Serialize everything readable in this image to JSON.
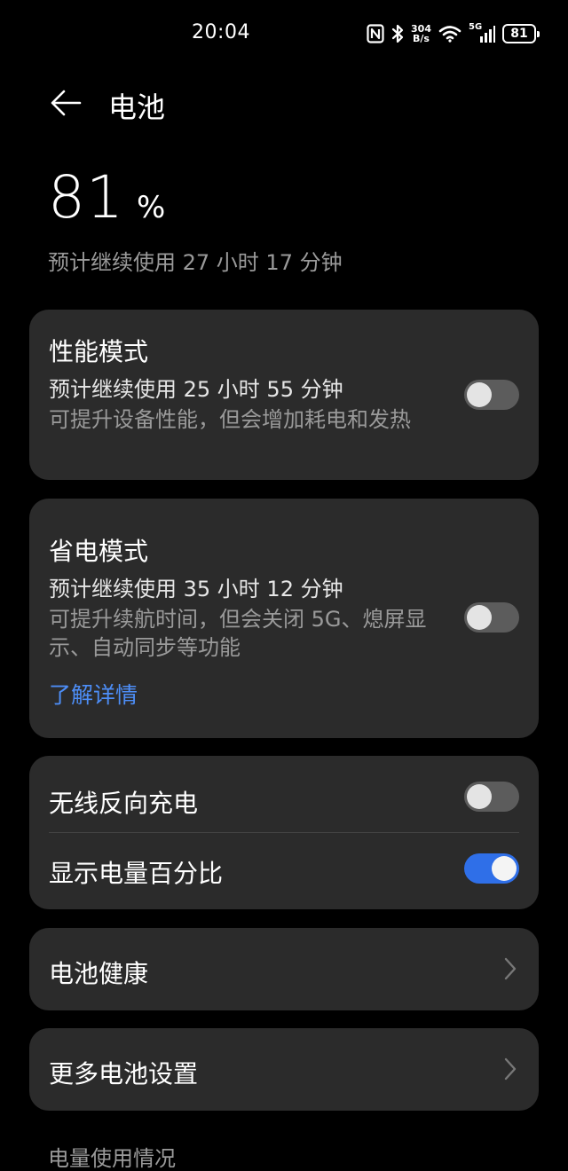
{
  "status_bar": {
    "time": "20:04",
    "net_speed_value": "304",
    "net_speed_unit": "B/s",
    "network": "5G",
    "battery": "81",
    "icons": [
      "nfc-icon",
      "bluetooth-icon",
      "wifi-icon",
      "cellular-signal-icon",
      "battery-icon"
    ]
  },
  "header": {
    "title": "电池",
    "back_icon": "arrow-left-icon"
  },
  "summary": {
    "percent": "81",
    "percent_unit": "%",
    "remaining": "预计继续使用 27 小时 17 分钟"
  },
  "performance_mode": {
    "title": "性能模式",
    "estimate": "预计继续使用 25 小时 55 分钟",
    "description": "可提升设备性能，但会增加耗电和发热",
    "enabled": false
  },
  "power_saving_mode": {
    "title": "省电模式",
    "estimate": "预计继续使用 35 小时 12 分钟",
    "description": "可提升续航时间，但会关闭 5G、熄屏显示、自动同步等功能",
    "link": "了解详情",
    "enabled": false
  },
  "toggles": {
    "wireless_reverse_charging": {
      "label": "无线反向充电",
      "enabled": false
    },
    "show_battery_percentage": {
      "label": "显示电量百分比",
      "enabled": true
    }
  },
  "nav_items": {
    "battery_health": "电池健康",
    "more_battery_settings": "更多电池设置"
  },
  "section": {
    "usage_label": "电量使用情况"
  },
  "colors": {
    "background": "#000000",
    "card": "#2b2b2b",
    "accent": "#2f6fe8",
    "link": "#4d8ef7",
    "secondary_text": "#9a9a9a"
  }
}
